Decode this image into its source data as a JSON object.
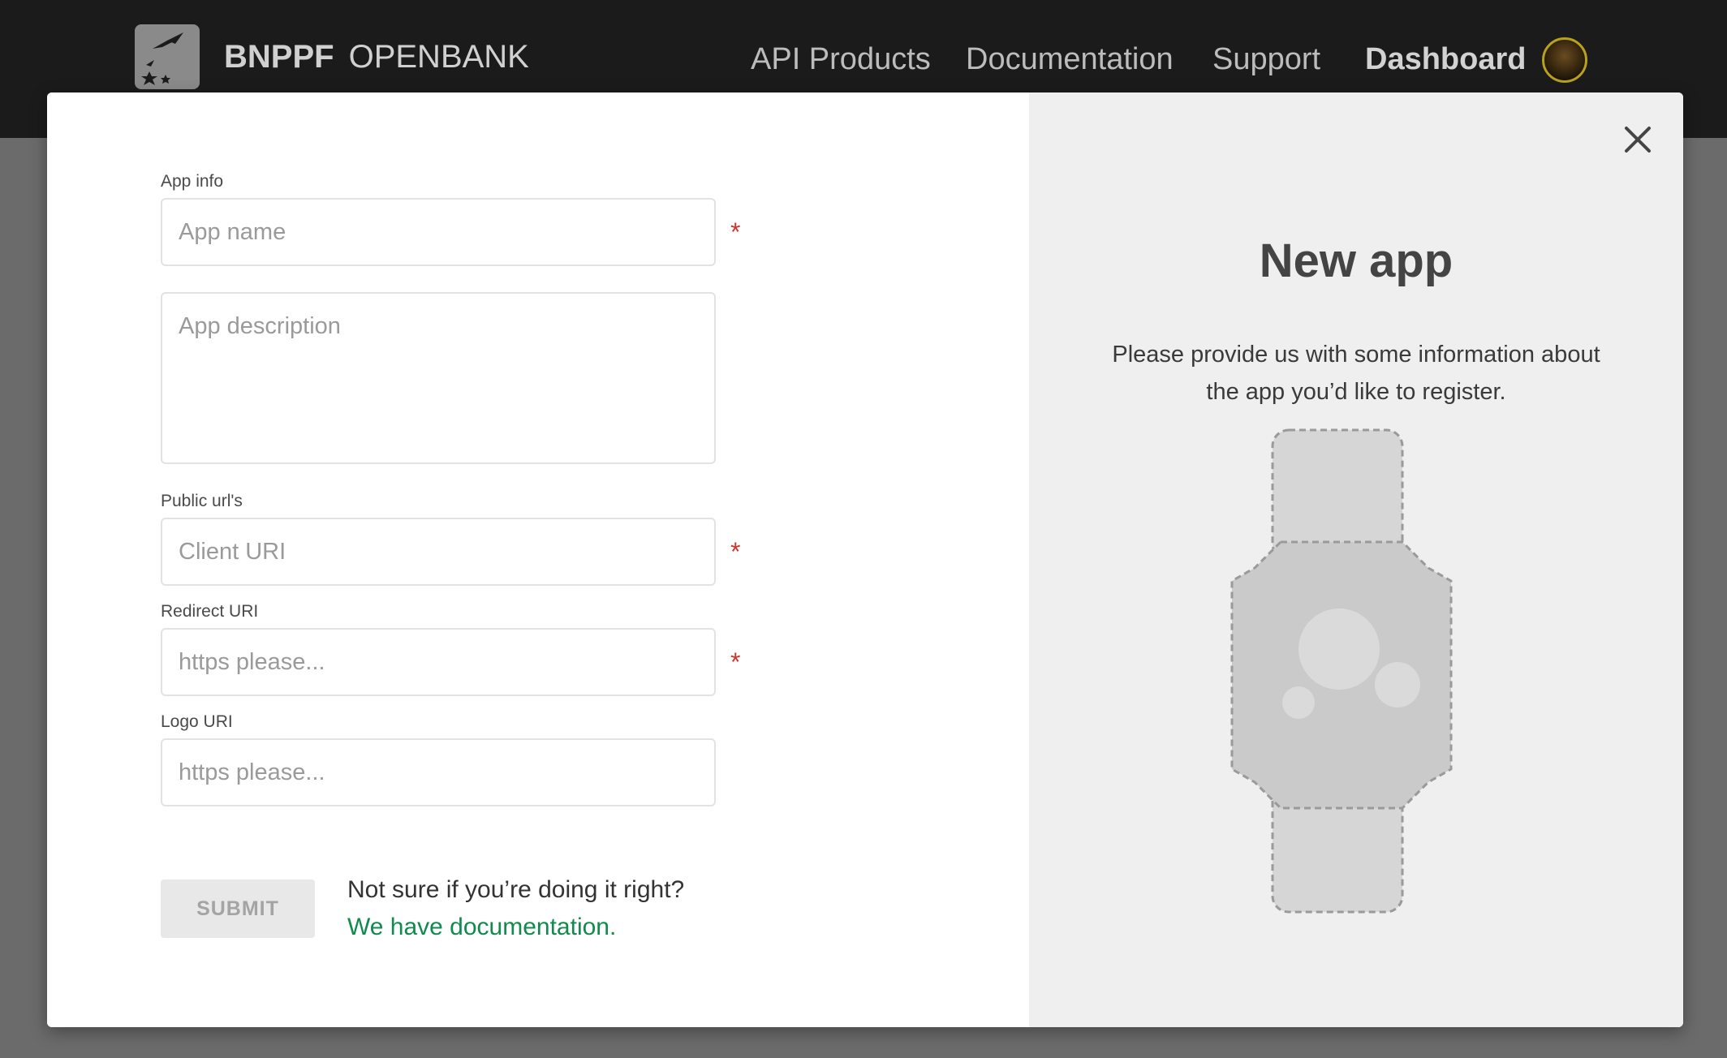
{
  "header": {
    "brand_bold": "BNPPF",
    "brand_light": "OPENBANK",
    "nav": {
      "api_products": "API Products",
      "documentation": "Documentation",
      "support": "Support",
      "dashboard": "Dashboard"
    }
  },
  "form": {
    "app_info_label": "App info",
    "app_name_placeholder": "App name",
    "app_description_placeholder": "App description",
    "public_urls_label": "Public url's",
    "client_uri_placeholder": "Client URI",
    "redirect_uri_label": "Redirect URI",
    "redirect_uri_placeholder": "https please...",
    "logo_uri_label": "Logo URI",
    "logo_uri_placeholder": "https please...",
    "required_marker": "*",
    "submit_label": "SUBMIT",
    "help_text": "Not sure if you’re doing it right?",
    "help_link": "We have documentation."
  },
  "panel": {
    "title": "New app",
    "description": "Please provide us with some information about the app you’d like to register."
  },
  "colors": {
    "topbar": "#1b1b1b",
    "required": "#d0342c",
    "link": "#118a4e",
    "panel_bg": "#efefef"
  },
  "icons": {
    "logo": "bnp-birds-logo",
    "close": "close-icon",
    "illustration": "smartwatch-illustration"
  }
}
